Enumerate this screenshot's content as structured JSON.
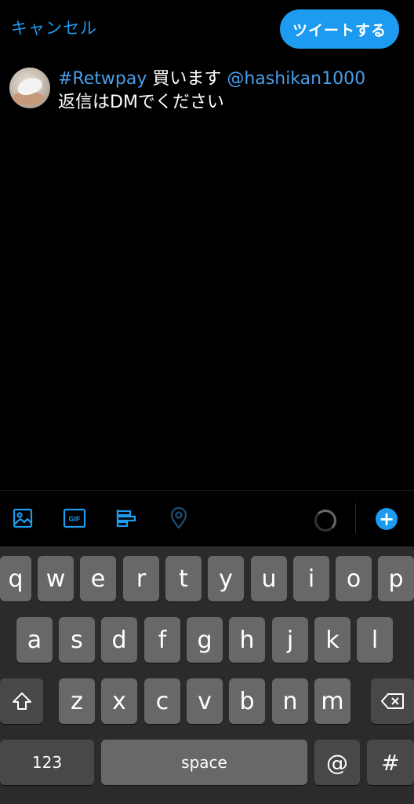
{
  "header": {
    "cancel_label": "キャンセル",
    "tweet_label": "ツイートする"
  },
  "compose": {
    "hashtag": "#Retwpay",
    "text1": " 買います ",
    "mention": "@hashikan1000",
    "line2": "返信はDMでください"
  },
  "toolbar": {
    "gif_label": "GIF",
    "plus_label": "+"
  },
  "keyboard": {
    "row1": [
      "q",
      "w",
      "e",
      "r",
      "t",
      "y",
      "u",
      "i",
      "o",
      "p"
    ],
    "row2": [
      "a",
      "s",
      "d",
      "f",
      "g",
      "h",
      "j",
      "k",
      "l"
    ],
    "row3": [
      "z",
      "x",
      "c",
      "v",
      "b",
      "n",
      "m"
    ],
    "numbers_label": "123",
    "space_label": "space",
    "at_label": "@",
    "hash_label": "#"
  },
  "colors": {
    "accent": "#1d9bf0",
    "link": "#4a9fe8",
    "background": "#000000",
    "keyboard_bg": "#2b2b2b",
    "key_bg": "#686868",
    "dark_key_bg": "#484848"
  }
}
